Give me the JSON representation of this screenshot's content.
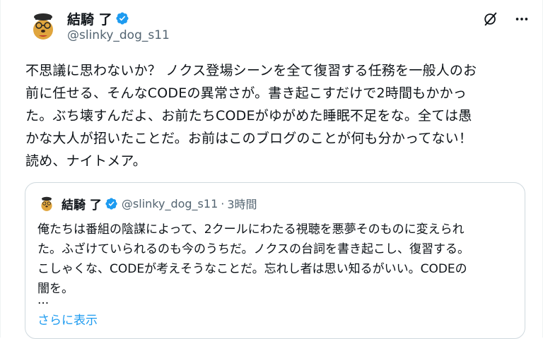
{
  "post": {
    "author": {
      "display_name": "結騎 了",
      "handle": "@slinky_dog_s11",
      "verified": true
    },
    "icons": {
      "grok": "grok-icon",
      "more": "more-icon",
      "verified": "verified-badge-icon"
    },
    "text": "不思議に思わないか？ ノクス登場シーンを全て復習する任務を一般人のお\n前に任せる、そんなCODEの異常さが。書き起こすだけで2時間もかかっ\nた。ぶち壊すんだよ、お前たちCODEがゆがめた睡眠不足をな。全ては愚\nかな大人が招いたことだ。お前はこのブログのことが何も分かってない！\n読め、ナイトメア。"
  },
  "quote": {
    "author": {
      "display_name": "結騎 了",
      "handle": "@slinky_dog_s11",
      "verified": true
    },
    "separator": "·",
    "time": "3時間",
    "text": "俺たちは番組の陰謀によって、2クールにわたる視聴を悪夢そのものに変えられ\nた。ふざけていられるのも今のうちだ。ノクスの台詞を書き起こし、復習する。\nこしゃくな、CODEが考えそうなことだ。忘れし者は思い知るがいい。CODEの\n闇を。",
    "ellipsis": "...",
    "show_more": "さらに表示"
  },
  "colors": {
    "text": "#0f1419",
    "secondary": "#536471",
    "link": "#1d9bf0",
    "verified": "#1d9bf0",
    "border": "#cfd9de"
  }
}
